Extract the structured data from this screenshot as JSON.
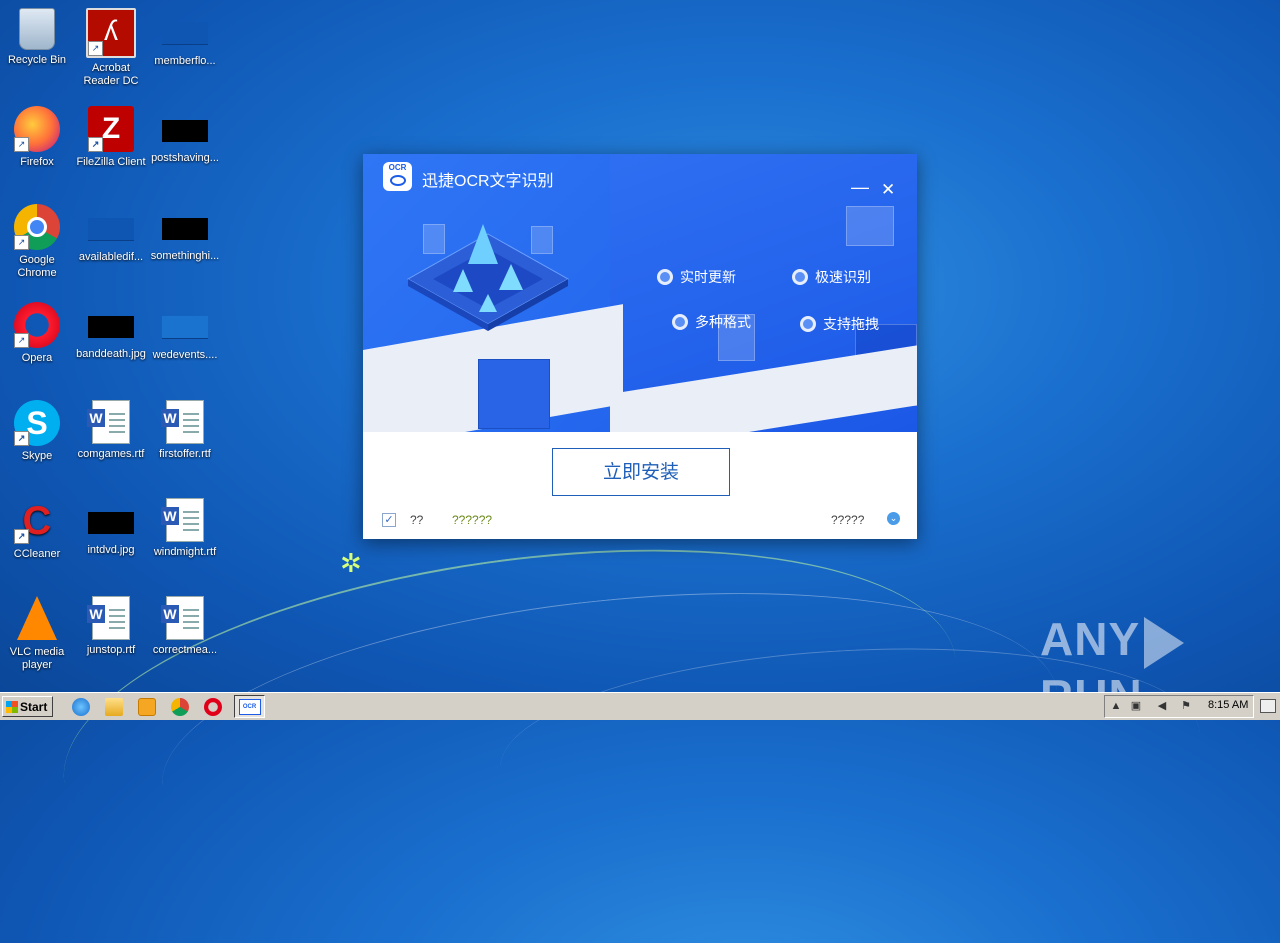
{
  "desktop": {
    "icons": [
      {
        "label": "Recycle Bin",
        "icon": "recycle-bin-icon"
      },
      {
        "label": "Acrobat Reader DC",
        "icon": "acrobat-icon"
      },
      {
        "label": "memberflo...",
        "icon": "file-thumbnail-icon"
      },
      {
        "label": "Firefox",
        "icon": "firefox-icon"
      },
      {
        "label": "FileZilla Client",
        "icon": "filezilla-icon"
      },
      {
        "label": "postshaving...",
        "icon": "file-thumbnail-icon"
      },
      {
        "label": "Google Chrome",
        "icon": "chrome-icon"
      },
      {
        "label": "availabledif...",
        "icon": "file-thumbnail-icon"
      },
      {
        "label": "somethinghi...",
        "icon": "file-thumbnail-icon"
      },
      {
        "label": "Opera",
        "icon": "opera-icon"
      },
      {
        "label": "banddeath.jpg",
        "icon": "image-file-icon"
      },
      {
        "label": "wedevents....",
        "icon": "file-thumbnail-icon"
      },
      {
        "label": "Skype",
        "icon": "skype-icon"
      },
      {
        "label": "comgames.rtf",
        "icon": "word-document-icon"
      },
      {
        "label": "firstoffer.rtf",
        "icon": "word-document-icon"
      },
      {
        "label": "CCleaner",
        "icon": "ccleaner-icon"
      },
      {
        "label": "intdvd.jpg",
        "icon": "image-file-icon"
      },
      {
        "label": "windmight.rtf",
        "icon": "word-document-icon"
      },
      {
        "label": "VLC media player",
        "icon": "vlc-icon"
      },
      {
        "label": "junstop.rtf",
        "icon": "word-document-icon"
      },
      {
        "label": "correctmea...",
        "icon": "word-document-icon"
      }
    ]
  },
  "installer": {
    "title": "迅捷OCR文字识别",
    "logo_text": "OCR",
    "features": [
      "实时更新",
      "极速识别",
      "多种格式",
      "支持拖拽"
    ],
    "install_button": "立即安装",
    "agree_checkbox_mark": "✓",
    "agree_text": "??",
    "agreement_link": "??????",
    "custom_install_text": "?????",
    "accent_color": "#1c5ce8"
  },
  "taskbar": {
    "start_label": "Start",
    "clock": "8:15 AM"
  },
  "watermark": {
    "left": "ANY",
    "right": "RUN"
  }
}
